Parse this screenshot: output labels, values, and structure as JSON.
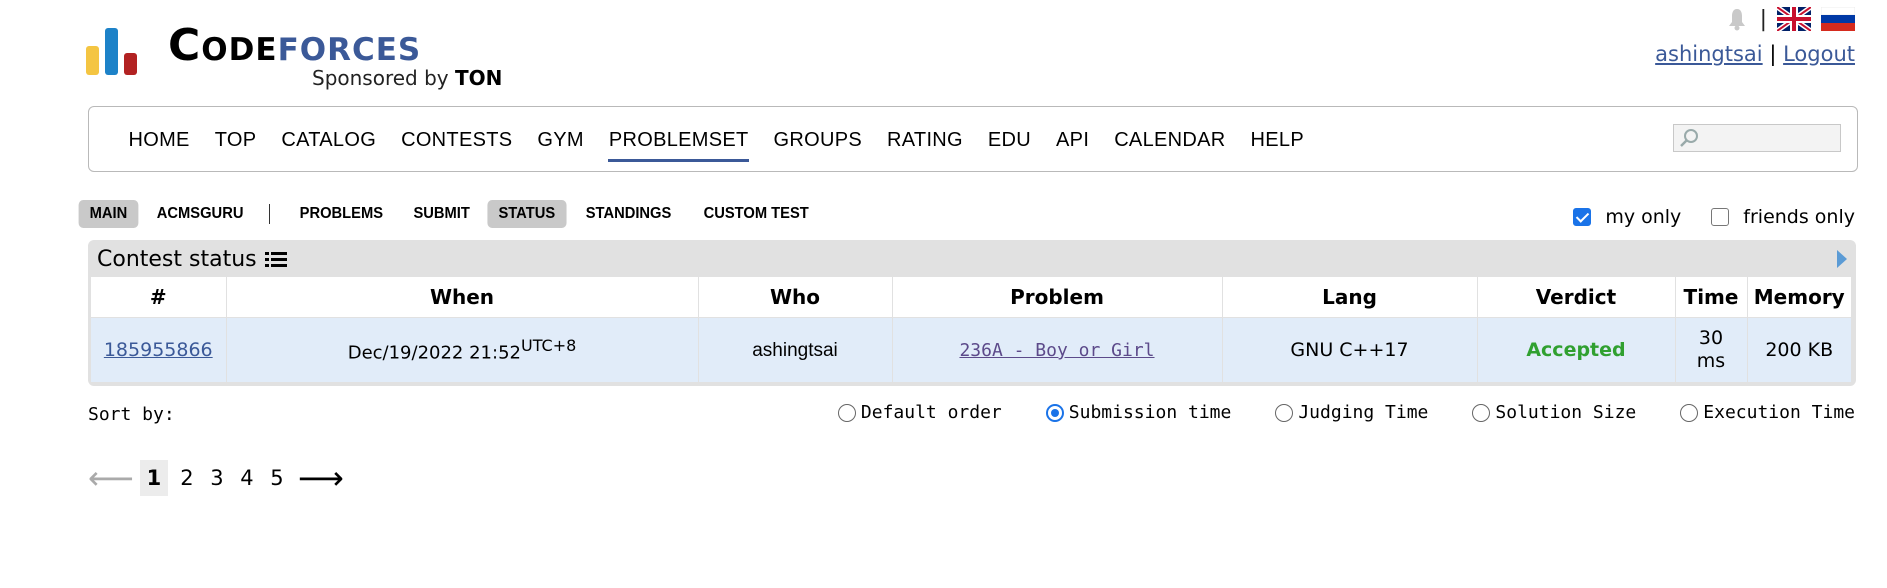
{
  "brand": {
    "word_code": "Code",
    "word_forces": "forces",
    "sponsored_by": "Sponsored by",
    "sponsor_name": "TON",
    "bar_colors": [
      "#f4c542",
      "#1d82c8",
      "#b22222"
    ]
  },
  "header": {
    "username": "ashingtsai",
    "separator": "|",
    "logout": "Logout",
    "icons": [
      "bell-icon",
      "flag-uk-icon",
      "flag-ru-icon"
    ]
  },
  "menu": {
    "items": [
      "HOME",
      "TOP",
      "CATALOG",
      "CONTESTS",
      "GYM",
      "PROBLEMSET",
      "GROUPS",
      "RATING",
      "EDU",
      "API",
      "CALENDAR",
      "HELP"
    ],
    "active": "PROBLEMSET",
    "search_placeholder": ""
  },
  "subnav": {
    "left": [
      "MAIN",
      "ACMSGURU"
    ],
    "right": [
      "PROBLEMS",
      "SUBMIT",
      "STATUS",
      "STANDINGS",
      "CUSTOM TEST"
    ],
    "selected": [
      "MAIN",
      "STATUS"
    ]
  },
  "filters": {
    "my_only": "my only",
    "my_only_checked": true,
    "friends_only": "friends only",
    "friends_only_checked": false
  },
  "status": {
    "title": "Contest status",
    "columns": [
      "#",
      "When",
      "Who",
      "Problem",
      "Lang",
      "Verdict",
      "Time",
      "Memory"
    ],
    "rows": [
      {
        "id": "185955866",
        "when": "Dec/19/2022 21:52",
        "when_tz": "UTC+8",
        "who": "ashingtsai",
        "problem": "236A - Boy or Girl",
        "lang": "GNU C++17",
        "verdict": "Accepted",
        "time_value": "30",
        "time_unit": "ms",
        "memory": "200 KB"
      }
    ]
  },
  "sort": {
    "label": "Sort by:",
    "options": [
      "Default order",
      "Submission time",
      "Judging Time",
      "Solution Size",
      "Execution Time"
    ],
    "selected": "Submission time"
  },
  "pagination": {
    "pages": [
      "1",
      "2",
      "3",
      "4",
      "5"
    ],
    "current": "1",
    "prev_arrow": "⟵",
    "next_arrow": "⟶"
  },
  "colors": {
    "accent": "#3b5998",
    "accepted": "#30a030",
    "row_bg": "#e1ecf9",
    "box_bg": "#e1e1e1"
  }
}
